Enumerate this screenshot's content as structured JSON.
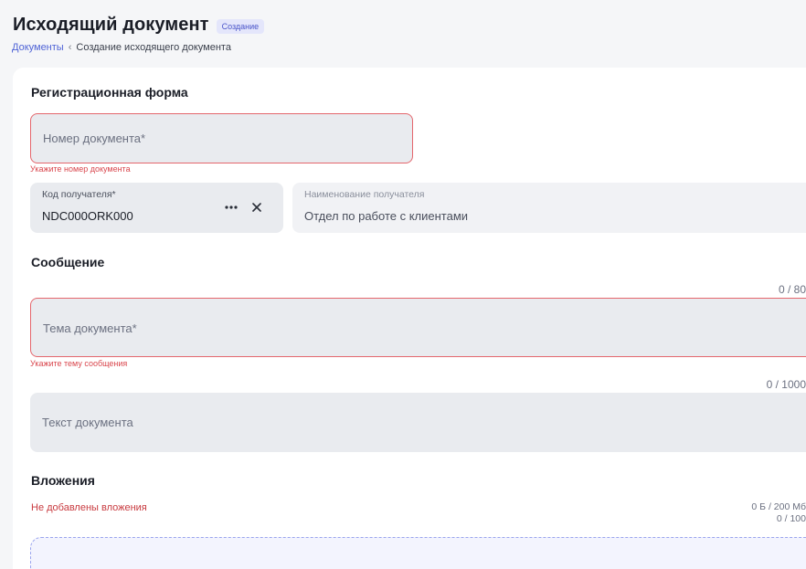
{
  "header": {
    "title": "Исходящий документ",
    "badge": "Создание",
    "breadcrumb": {
      "link": "Документы",
      "separator": "‹",
      "current": "Создание исходящего документа"
    }
  },
  "registration": {
    "title": "Регистрационная форма",
    "doc_number": {
      "placeholder": "Номер документа*",
      "error": "Укажите номер документа"
    },
    "recipient_code": {
      "label": "Код получателя*",
      "value": "NDC000ORK000",
      "more_icon": "more-horizontal-icon",
      "clear_icon": "close-icon"
    },
    "recipient_name": {
      "label": "Наименование получателя",
      "value": "Отдел по работе с клиентами"
    }
  },
  "message": {
    "title": "Сообщение",
    "subject": {
      "counter": "0 / 80",
      "placeholder": "Тема документа*",
      "error": "Укажите тему сообщения"
    },
    "body": {
      "counter": "0 / 1000",
      "placeholder": "Текст документа"
    }
  },
  "attachments": {
    "title": "Вложения",
    "empty_text": "Не добавлены вложения",
    "size": "0 Б / 200 Мб",
    "count": "0 / 100"
  },
  "colors": {
    "accent": "#4f63d6",
    "error": "#e4666c",
    "field_bg": "#e9ebef"
  }
}
